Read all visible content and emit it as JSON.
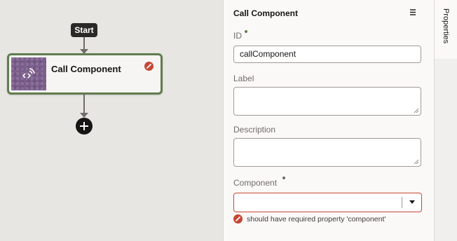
{
  "canvas": {
    "start_label": "Start",
    "node": {
      "title": "Call Component",
      "icon": "call-component-icon",
      "tile_color": "#7b5e8c",
      "border_color": "#5f7d4f",
      "status": "error"
    }
  },
  "panel": {
    "title": "Call Component",
    "fields": {
      "id": {
        "label": "ID",
        "value": "callComponent",
        "required": true
      },
      "label": {
        "label": "Label",
        "value": ""
      },
      "description": {
        "label": "Description",
        "value": ""
      },
      "component": {
        "label": "Component",
        "value": "",
        "required": true,
        "error": "should have required property 'component'"
      }
    }
  },
  "side_tab": {
    "label": "Properties"
  },
  "colors": {
    "error": "#c74634",
    "success": "#5f7d4f",
    "required_dot_id": "#5f7d4f",
    "required_dot_component": "#6f6c69"
  }
}
